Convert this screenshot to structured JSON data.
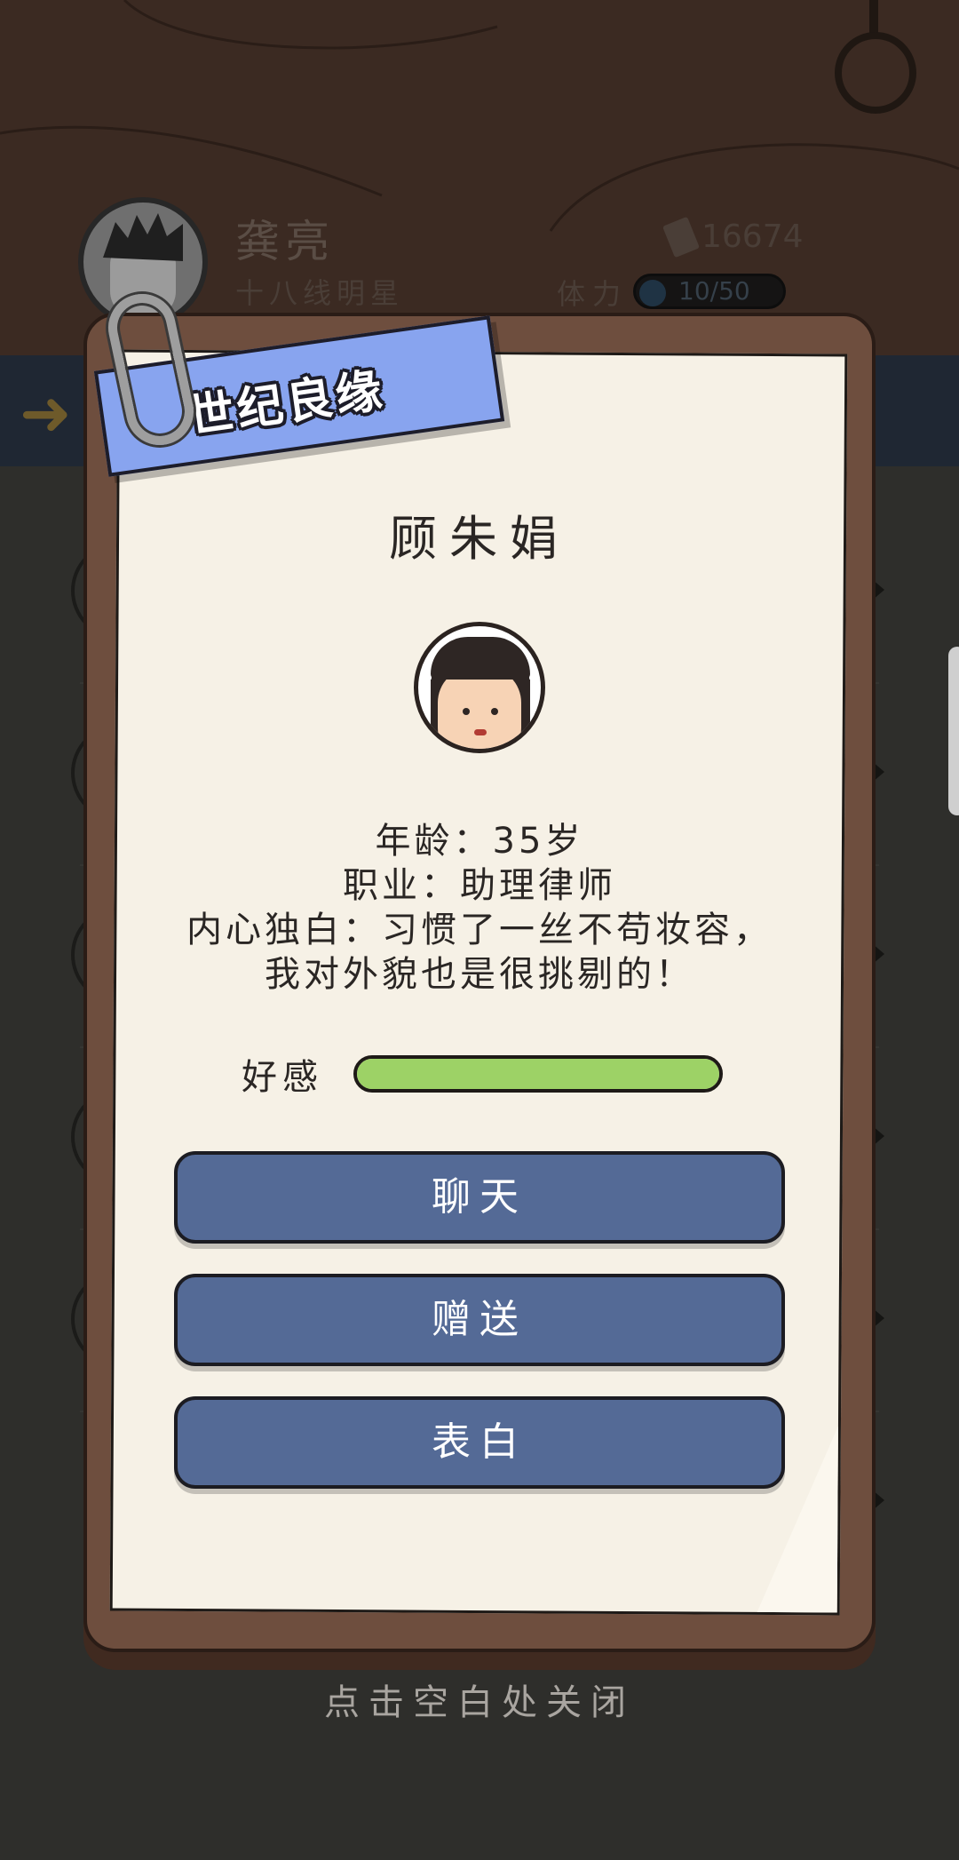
{
  "player": {
    "name": "龚亮",
    "title": "十八线明星",
    "money": "16674",
    "stamina_label": "体力",
    "stamina": "10/50"
  },
  "dialog": {
    "banner_title": "世纪良缘",
    "character_name": "顾朱娟",
    "age_line": "年龄：35岁",
    "job_line": "职业：助理律师",
    "monologue_line1": "内心独白：习惯了一丝不苟妆容，",
    "monologue_line2": "我对外貌也是很挑剔的！",
    "favor_label": "好感",
    "favor_level": 1.0,
    "buttons": {
      "chat": "聊天",
      "gift": "赠送",
      "confess": "表白"
    },
    "close_hint": "点击空白处关闭"
  },
  "colors": {
    "card_brown": "#6e4e3e",
    "paper": "#f6f1e6",
    "banner_blue": "#88a4ef",
    "button_blue": "#546a96",
    "favor_green": "#9dd266"
  },
  "icons": [
    "back-arrow-icon",
    "money-icon",
    "ring-icon",
    "paperclip-icon"
  ]
}
